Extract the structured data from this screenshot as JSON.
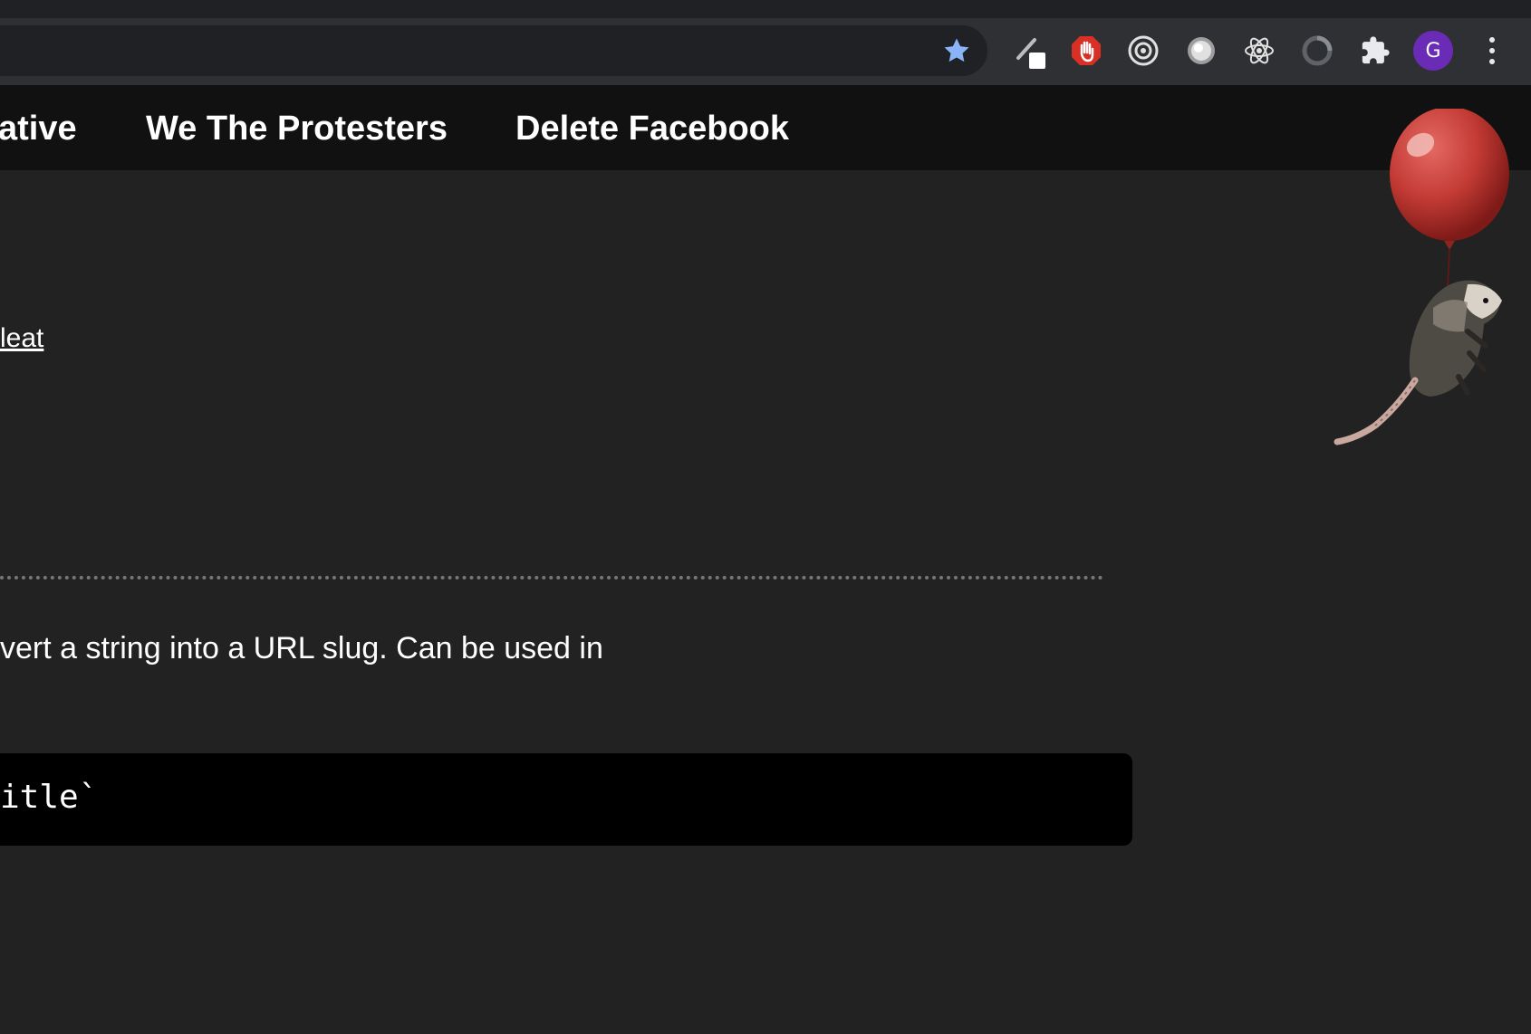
{
  "browser": {
    "avatar_initial": "G",
    "colors": {
      "toolbar": "#2f3033",
      "omnibox": "#202124",
      "star": "#8ab4f8",
      "avatar": "#6a2bb7",
      "block_extension": "#d93025"
    },
    "extension_icons": [
      "pencil-extension-icon",
      "hand-stop-extension-icon",
      "target-extension-icon",
      "circle-extension-icon",
      "react-atom-extension-icon",
      "loading-ring-extension-icon",
      "puzzle-extensions-icon"
    ]
  },
  "nav": {
    "items": [
      {
        "label": "ative"
      },
      {
        "label": "We The Protesters"
      },
      {
        "label": "Delete Facebook"
      }
    ]
  },
  "content": {
    "link_fragment": "leat",
    "paragraph": "vert a string into a URL slug. Can be used in",
    "code": "itle`"
  },
  "mascot": {
    "description_icon": "opossum-with-red-balloon-icon"
  }
}
